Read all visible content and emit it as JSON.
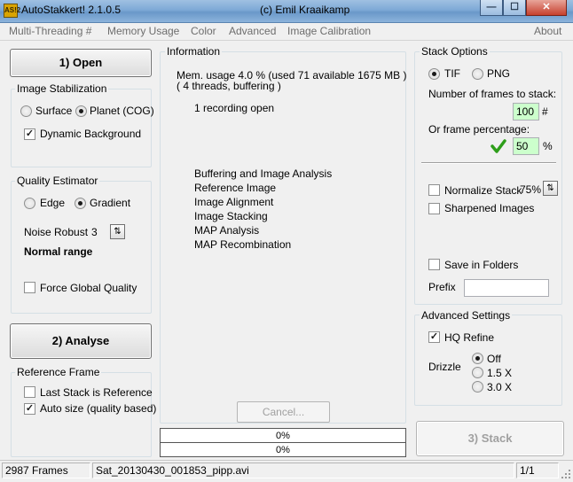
{
  "window": {
    "title": "AutoStakkert! 2.1.0.5",
    "author": "(c) Emil Kraaikamp",
    "icon_text": "AS!2",
    "minimize": "—",
    "maximize": "☐",
    "close": "✕"
  },
  "menu": {
    "items": [
      "Multi-Threading #",
      "Memory Usage",
      "Color",
      "Advanced",
      "Image Calibration"
    ],
    "about": "About"
  },
  "left": {
    "open_button": "1) Open",
    "stabilization": {
      "title": "Image Stabilization",
      "surface": "Surface",
      "planet": "Planet (COG)",
      "selected": "planet",
      "dynamic_background": "Dynamic Background",
      "dynamic_background_checked": true
    },
    "quality": {
      "title": "Quality Estimator",
      "edge": "Edge",
      "gradient": "Gradient",
      "selected": "gradient",
      "noise_robust_label": "Noise Robust",
      "noise_robust_value": "3",
      "range_label": "Normal range",
      "force_global": "Force Global Quality",
      "force_global_checked": false
    },
    "analyse_button": "2) Analyse",
    "reference": {
      "title": "Reference Frame",
      "last_stack": "Last Stack is Reference",
      "last_stack_checked": false,
      "auto_size": "Auto size (quality based)",
      "auto_size_checked": true
    }
  },
  "info": {
    "title": "Information",
    "mem_line1": "Mem. usage 4.0 %  (used 71 available 1675 MB )",
    "mem_line2": "( 4 threads, buffering )",
    "recording": "1 recording open",
    "steps": [
      "Buffering and Image Analysis",
      "Reference Image",
      "Image Alignment",
      "Image Stacking",
      "MAP Analysis",
      "MAP Recombination"
    ],
    "cancel_button": "Cancel...",
    "progress1": "0%",
    "progress2": "0%",
    "progress1_value": 0,
    "progress2_value": 0
  },
  "stack": {
    "title": "Stack Options",
    "tif": "TIF",
    "png": "PNG",
    "selected_format": "tif",
    "frames_label": "Number of frames to stack:",
    "frames_value": "100",
    "frames_unit": "#",
    "percent_label": "Or frame percentage:",
    "percent_value": "50",
    "percent_unit": "%",
    "normalize": "Normalize Stack",
    "normalize_checked": false,
    "normalize_value": "75%",
    "sharpened": "Sharpened Images",
    "sharpened_checked": false,
    "save_folders": "Save in Folders",
    "save_folders_checked": false,
    "prefix_label": "Prefix",
    "prefix_value": ""
  },
  "advanced": {
    "title": "Advanced Settings",
    "hq_refine": "HQ Refine",
    "hq_refine_checked": true,
    "drizzle_label": "Drizzle",
    "drizzle_off": "Off",
    "drizzle_15": "1.5 X",
    "drizzle_30": "3.0 X",
    "drizzle_selected": "off",
    "stack_button": "3) Stack"
  },
  "status": {
    "frames": "2987 Frames",
    "file": "Sat_20130430_001853_pipp.avi",
    "page": "1/1"
  },
  "colors": {
    "green_field": "#ccffcc",
    "check_green": "#2e9e1a"
  }
}
